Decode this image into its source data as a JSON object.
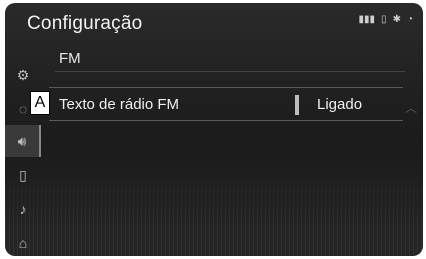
{
  "header": {
    "title": "Configuração"
  },
  "status_icons": [
    "signal-icon",
    "battery-icon",
    "bluetooth-icon",
    "wifi-icon"
  ],
  "section": {
    "label": "FM"
  },
  "settings": [
    {
      "label": "Texto de rádio FM",
      "value": "Ligado"
    }
  ],
  "callout": {
    "label": "A"
  },
  "sidebar": {
    "items": [
      {
        "icon": "gear-icon"
      },
      {
        "icon": "settings-icon-2"
      },
      {
        "icon": "speaker-icon"
      },
      {
        "icon": "phone-icon"
      },
      {
        "icon": "voice-icon"
      },
      {
        "icon": "car-icon"
      }
    ]
  }
}
